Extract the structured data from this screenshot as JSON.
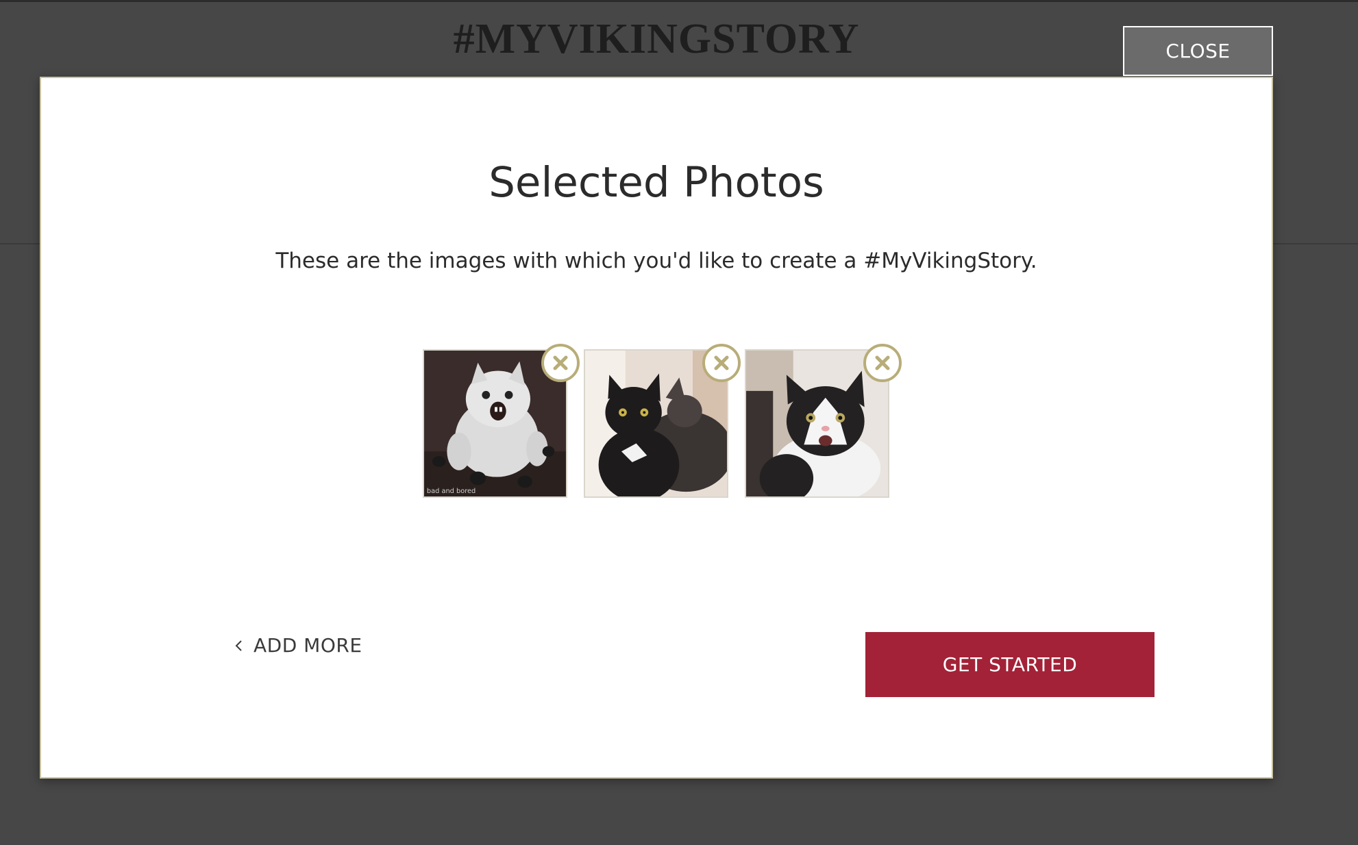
{
  "header": {
    "site_title": "#MYVIKINGSTORY",
    "close_label": "CLOSE"
  },
  "modal": {
    "title": "Selected Photos",
    "subtitle": "These are the images with which you'd like to create a #MyVikingStory.",
    "photos": [
      {
        "subject": "fluffy white kitten hissing",
        "caption": "bad and bored"
      },
      {
        "subject": "black cat with white chest"
      },
      {
        "subject": "black and white cat with open mouth"
      }
    ],
    "remove_icon": "close-circle-icon",
    "add_more_label": "ADD MORE",
    "get_started_label": "GET STARTED"
  },
  "colors": {
    "backdrop": "#474747",
    "accent_gold": "#b8ad78",
    "primary_button": "#a32237",
    "close_button": "#6b6b6b"
  }
}
